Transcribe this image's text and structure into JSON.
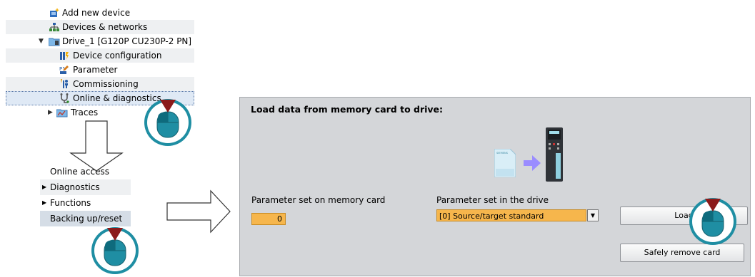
{
  "tree": {
    "items": [
      {
        "label": "Add new device",
        "icon": "add-device-icon"
      },
      {
        "label": "Devices & networks",
        "icon": "network-icon"
      },
      {
        "label": "Drive_1 [G120P CU230P-2 PN]",
        "icon": "drive-folder-icon",
        "expanded": true
      },
      {
        "label": "Device configuration",
        "icon": "device-config-icon"
      },
      {
        "label": "Parameter",
        "icon": "parameter-icon"
      },
      {
        "label": "Commissioning",
        "icon": "commissioning-icon"
      },
      {
        "label": "Online & diagnostics",
        "icon": "online-diagnostics-icon",
        "selected": true
      },
      {
        "label": "Traces",
        "icon": "traces-icon",
        "collapsed": true
      }
    ]
  },
  "menu": {
    "items": [
      {
        "label": "Online access"
      },
      {
        "label": "Diagnostics",
        "has_submenu": true
      },
      {
        "label": "Functions",
        "has_submenu": true
      },
      {
        "label": "Backing up/reset",
        "active": true
      }
    ]
  },
  "panel": {
    "title": "Load data from memory card to drive:",
    "card_label": "Parameter set on memory card",
    "card_value": "0",
    "drive_label": "Parameter set in the drive",
    "drive_value": "[0] Source/target standard",
    "load_button": "Load",
    "remove_button": "Safely remove card",
    "card_brand": "SIEMENS"
  },
  "colors": {
    "accent_field": "#f6b64c",
    "panel_bg": "#d4d6d9",
    "mouse_teal": "#1f8ea3",
    "click_red": "#8b1a1a",
    "transfer_arrow": "#9a8cff"
  }
}
